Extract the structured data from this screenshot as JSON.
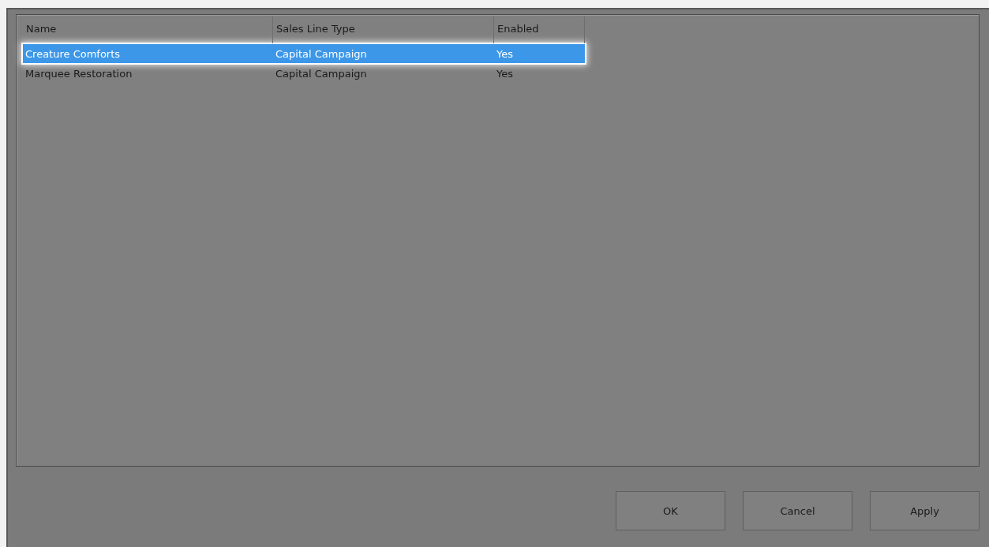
{
  "table": {
    "columns": [
      "Name",
      "Sales Line Type",
      "Enabled"
    ],
    "rows": [
      {
        "cells": [
          "Creature Comforts",
          "Capital Campaign",
          "Yes"
        ],
        "selected": true
      },
      {
        "cells": [
          "Marquee Restoration",
          "Capital Campaign",
          "Yes"
        ],
        "selected": false
      }
    ]
  },
  "buttons": [
    "OK",
    "Cancel",
    "Apply"
  ]
}
